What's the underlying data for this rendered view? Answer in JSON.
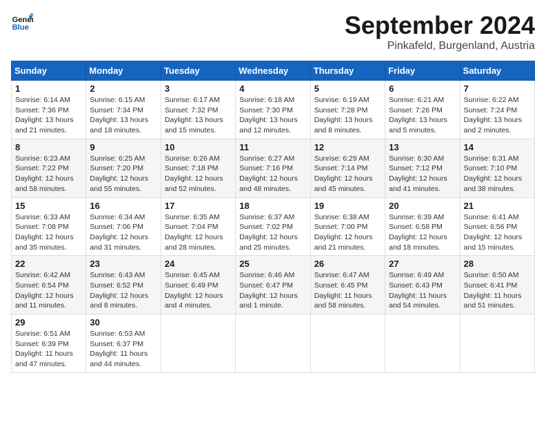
{
  "header": {
    "logo_line1": "General",
    "logo_line2": "Blue",
    "title": "September 2024",
    "subtitle": "Pinkafeld, Burgenland, Austria"
  },
  "calendar": {
    "days_of_week": [
      "Sunday",
      "Monday",
      "Tuesday",
      "Wednesday",
      "Thursday",
      "Friday",
      "Saturday"
    ],
    "weeks": [
      [
        {
          "day": "1",
          "info": "Sunrise: 6:14 AM\nSunset: 7:36 PM\nDaylight: 13 hours\nand 21 minutes."
        },
        {
          "day": "2",
          "info": "Sunrise: 6:15 AM\nSunset: 7:34 PM\nDaylight: 13 hours\nand 18 minutes."
        },
        {
          "day": "3",
          "info": "Sunrise: 6:17 AM\nSunset: 7:32 PM\nDaylight: 13 hours\nand 15 minutes."
        },
        {
          "day": "4",
          "info": "Sunrise: 6:18 AM\nSunset: 7:30 PM\nDaylight: 13 hours\nand 12 minutes."
        },
        {
          "day": "5",
          "info": "Sunrise: 6:19 AM\nSunset: 7:28 PM\nDaylight: 13 hours\nand 8 minutes."
        },
        {
          "day": "6",
          "info": "Sunrise: 6:21 AM\nSunset: 7:26 PM\nDaylight: 13 hours\nand 5 minutes."
        },
        {
          "day": "7",
          "info": "Sunrise: 6:22 AM\nSunset: 7:24 PM\nDaylight: 13 hours\nand 2 minutes."
        }
      ],
      [
        {
          "day": "8",
          "info": "Sunrise: 6:23 AM\nSunset: 7:22 PM\nDaylight: 12 hours\nand 58 minutes."
        },
        {
          "day": "9",
          "info": "Sunrise: 6:25 AM\nSunset: 7:20 PM\nDaylight: 12 hours\nand 55 minutes."
        },
        {
          "day": "10",
          "info": "Sunrise: 6:26 AM\nSunset: 7:18 PM\nDaylight: 12 hours\nand 52 minutes."
        },
        {
          "day": "11",
          "info": "Sunrise: 6:27 AM\nSunset: 7:16 PM\nDaylight: 12 hours\nand 48 minutes."
        },
        {
          "day": "12",
          "info": "Sunrise: 6:29 AM\nSunset: 7:14 PM\nDaylight: 12 hours\nand 45 minutes."
        },
        {
          "day": "13",
          "info": "Sunrise: 6:30 AM\nSunset: 7:12 PM\nDaylight: 12 hours\nand 41 minutes."
        },
        {
          "day": "14",
          "info": "Sunrise: 6:31 AM\nSunset: 7:10 PM\nDaylight: 12 hours\nand 38 minutes."
        }
      ],
      [
        {
          "day": "15",
          "info": "Sunrise: 6:33 AM\nSunset: 7:08 PM\nDaylight: 12 hours\nand 35 minutes."
        },
        {
          "day": "16",
          "info": "Sunrise: 6:34 AM\nSunset: 7:06 PM\nDaylight: 12 hours\nand 31 minutes."
        },
        {
          "day": "17",
          "info": "Sunrise: 6:35 AM\nSunset: 7:04 PM\nDaylight: 12 hours\nand 28 minutes."
        },
        {
          "day": "18",
          "info": "Sunrise: 6:37 AM\nSunset: 7:02 PM\nDaylight: 12 hours\nand 25 minutes."
        },
        {
          "day": "19",
          "info": "Sunrise: 6:38 AM\nSunset: 7:00 PM\nDaylight: 12 hours\nand 21 minutes."
        },
        {
          "day": "20",
          "info": "Sunrise: 6:39 AM\nSunset: 6:58 PM\nDaylight: 12 hours\nand 18 minutes."
        },
        {
          "day": "21",
          "info": "Sunrise: 6:41 AM\nSunset: 6:56 PM\nDaylight: 12 hours\nand 15 minutes."
        }
      ],
      [
        {
          "day": "22",
          "info": "Sunrise: 6:42 AM\nSunset: 6:54 PM\nDaylight: 12 hours\nand 11 minutes."
        },
        {
          "day": "23",
          "info": "Sunrise: 6:43 AM\nSunset: 6:52 PM\nDaylight: 12 hours\nand 8 minutes."
        },
        {
          "day": "24",
          "info": "Sunrise: 6:45 AM\nSunset: 6:49 PM\nDaylight: 12 hours\nand 4 minutes."
        },
        {
          "day": "25",
          "info": "Sunrise: 6:46 AM\nSunset: 6:47 PM\nDaylight: 12 hours\nand 1 minute."
        },
        {
          "day": "26",
          "info": "Sunrise: 6:47 AM\nSunset: 6:45 PM\nDaylight: 11 hours\nand 58 minutes."
        },
        {
          "day": "27",
          "info": "Sunrise: 6:49 AM\nSunset: 6:43 PM\nDaylight: 11 hours\nand 54 minutes."
        },
        {
          "day": "28",
          "info": "Sunrise: 6:50 AM\nSunset: 6:41 PM\nDaylight: 11 hours\nand 51 minutes."
        }
      ],
      [
        {
          "day": "29",
          "info": "Sunrise: 6:51 AM\nSunset: 6:39 PM\nDaylight: 11 hours\nand 47 minutes."
        },
        {
          "day": "30",
          "info": "Sunrise: 6:53 AM\nSunset: 6:37 PM\nDaylight: 11 hours\nand 44 minutes."
        },
        {
          "day": "",
          "info": ""
        },
        {
          "day": "",
          "info": ""
        },
        {
          "day": "",
          "info": ""
        },
        {
          "day": "",
          "info": ""
        },
        {
          "day": "",
          "info": ""
        }
      ]
    ]
  }
}
